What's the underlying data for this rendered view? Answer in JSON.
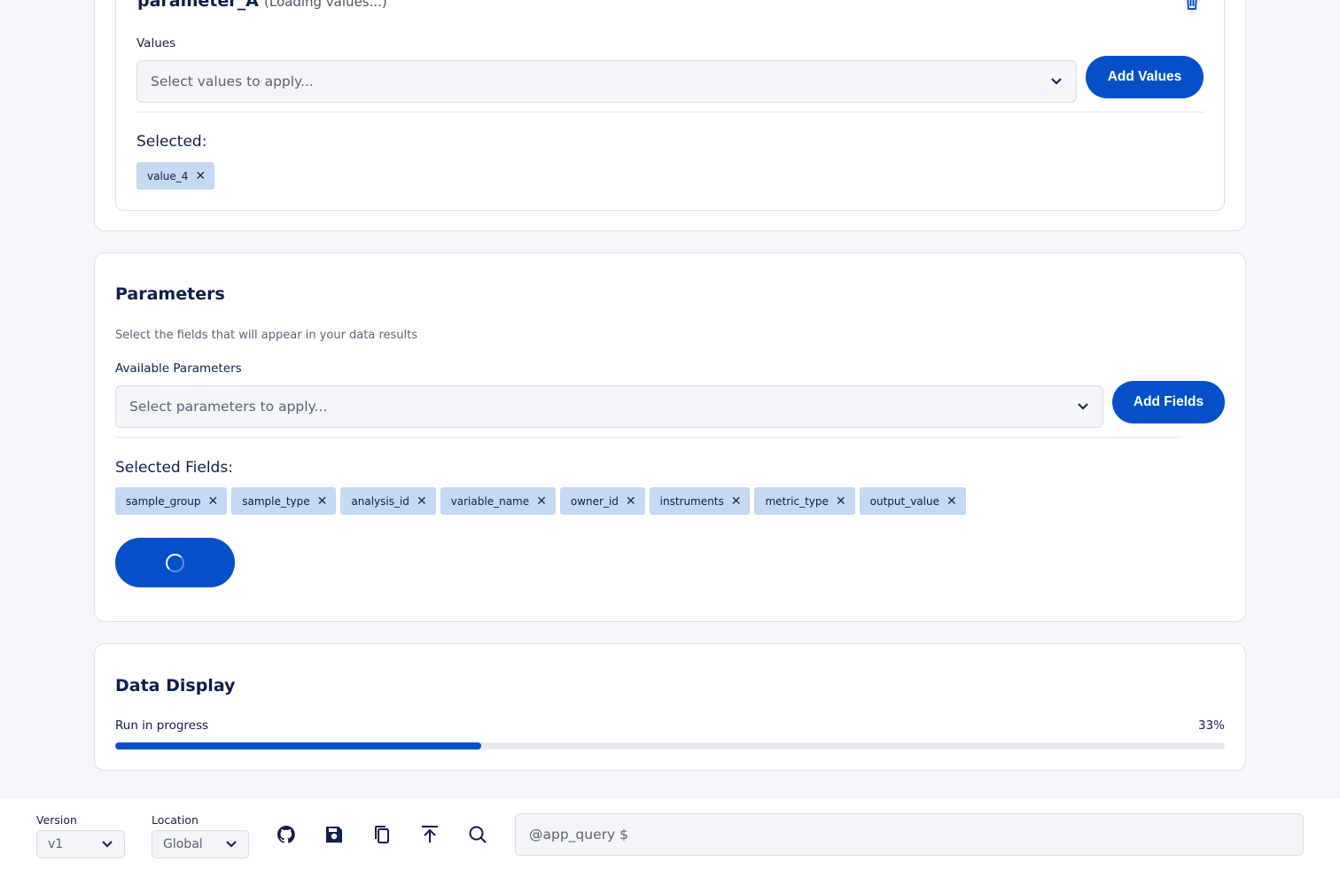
{
  "filter_card": {
    "parameter_name": "parameter_A",
    "loading_text": "(Loading values...)",
    "values_label": "Values",
    "values_placeholder": "Select values to apply...",
    "add_values_label": "Add Values",
    "selected_title": "Selected:",
    "selected_values": [
      "value_4"
    ]
  },
  "parameters": {
    "title": "Parameters",
    "description": "Select the fields that will appear in your data results",
    "available_label": "Available Parameters",
    "select_placeholder": "Select parameters to apply...",
    "add_fields_label": "Add Fields",
    "selected_title": "Selected Fields:",
    "selected_fields": [
      "sample_group",
      "sample_type",
      "analysis_id",
      "variable_name",
      "owner_id",
      "instruments",
      "metric_type",
      "output_value"
    ],
    "remove_glyph": "✕"
  },
  "data_display": {
    "title": "Data Display",
    "progress_label": "Run in progress",
    "progress_percent_text": "33%",
    "progress_fraction": 0.33
  },
  "bottom_bar": {
    "version_label": "Version",
    "version_value": "v1",
    "location_label": "Location",
    "location_value": "Global",
    "icons": [
      "github-icon",
      "save-icon",
      "copy-icon",
      "upload-icon",
      "search-icon"
    ],
    "query_placeholder": "@app_query $"
  },
  "colors": {
    "primary": "#0550c9",
    "chip_bg": "#c5d8f4",
    "heading": "#0f1f4b",
    "page_bg": "#f5f7fa"
  }
}
